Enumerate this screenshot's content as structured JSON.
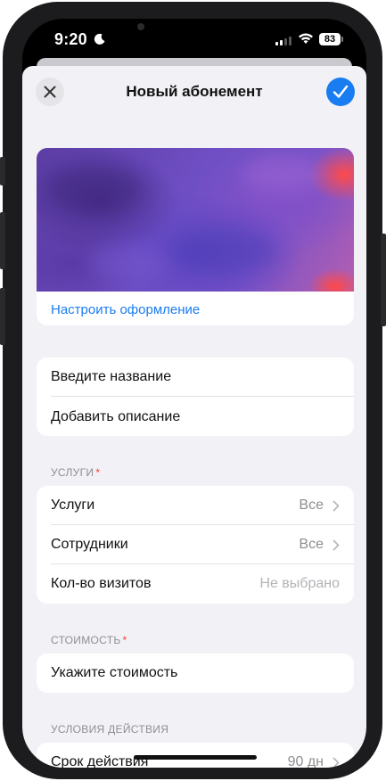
{
  "status_bar": {
    "time": "9:20",
    "moon_icon": "moon-icon",
    "battery": "83"
  },
  "nav": {
    "title": "Новый абонемент",
    "close_icon": "close-icon",
    "done_icon": "checkmark-icon"
  },
  "cover": {
    "customize_label": "Настроить оформление"
  },
  "name": {
    "placeholder": "Введите название",
    "add_description": "Добавить описание"
  },
  "services_section": {
    "header": "УСЛУГИ",
    "required_mark": "*",
    "rows": [
      {
        "label": "Услуги",
        "value": "Все"
      },
      {
        "label": "Сотрудники",
        "value": "Все"
      },
      {
        "label": "Кол-во визитов",
        "value": "Не выбрано"
      }
    ]
  },
  "price_section": {
    "header": "СТОИМОСТЬ",
    "required_mark": "*",
    "placeholder": "Укажите стоимость"
  },
  "conditions_section": {
    "header": "УСЛОВИЯ ДЕЙСТВИЯ",
    "row_label": "Срок действия",
    "row_value": "90 дн"
  },
  "colors": {
    "accent": "#1a7cf1",
    "background": "#f2f1f6",
    "required": "#ff3b30"
  }
}
